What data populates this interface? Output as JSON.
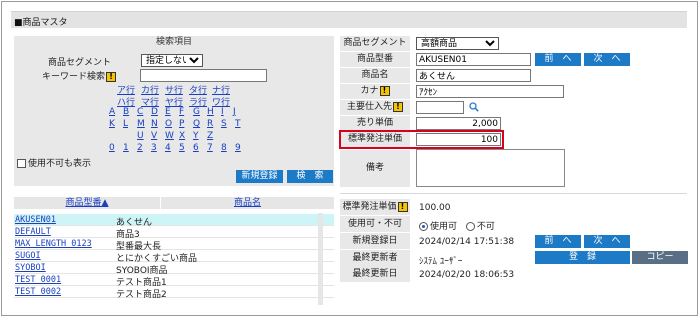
{
  "title": "■商品マスタ",
  "search": {
    "header": "検索項目",
    "segment_label": "商品セグメント",
    "segment_value": "指定しない",
    "keyword_label": "キーワード検索",
    "keyword_value": "",
    "kana_rows": [
      [
        "ア行",
        "カ行",
        "サ行",
        "タ行",
        "ナ行"
      ],
      [
        "ハ行",
        "マ行",
        "ヤ行",
        "ラ行",
        "ワ行"
      ],
      [
        "A",
        "B",
        "C",
        "D",
        "E",
        "F",
        "G",
        "H",
        "I",
        "J"
      ],
      [
        "K",
        "L",
        "M",
        "N",
        "O",
        "P",
        "Q",
        "R",
        "S",
        "T"
      ],
      [
        "U",
        "V",
        "W",
        "X",
        "Y",
        "Z"
      ],
      [
        "0",
        "1",
        "2",
        "3",
        "4",
        "5",
        "6",
        "7",
        "8",
        "9"
      ]
    ],
    "unusable_label": "使用不可も表示",
    "new_button": "新規登録",
    "search_button": "検　索"
  },
  "list": {
    "col_code": "商品型番▲",
    "col_name": "商品名",
    "rows": [
      {
        "code": "AKUSEN01",
        "name": "あくせん"
      },
      {
        "code": "DEFAULT",
        "name": "商品3"
      },
      {
        "code": "MAX LENGTH 0123",
        "name": "型番最大長"
      },
      {
        "code": "SUGOI",
        "name": "とにかくすごい商品"
      },
      {
        "code": "SYOBOI",
        "name": "SYOBOI商品"
      },
      {
        "code": "TEST 0001",
        "name": "テスト商品1"
      },
      {
        "code": "TEST 0002",
        "name": "テスト商品2"
      }
    ]
  },
  "edit": {
    "segment_label": "商品セグメント",
    "segment_value": "高額商品",
    "code_label": "商品型番",
    "code_value": "AKUSEN01",
    "prev_button": "前　へ",
    "next_button": "次　へ",
    "name_label": "商品名",
    "name_value": "あくせん",
    "kana_label": "カナ",
    "kana_value": "ｱｸｾﾝ",
    "supplier_label": "主要仕入先",
    "supplier_value": "",
    "sale_price_label": "売り単価",
    "sale_price_value": "2,000",
    "std_price_label": "標準発注単価",
    "std_price_value": "100",
    "memo_label": "備考",
    "memo_value": ""
  },
  "detail": {
    "std_price_label": "標準発注単価",
    "std_price_value": "100.00",
    "usable_label": "使用可・不可",
    "usable_yes": "使用可",
    "usable_no": "不可",
    "created_label": "新規登録日",
    "created_value": "2024/02/14 17:51:38",
    "updater_label": "最終更新者",
    "updater_value": "ｼｽﾃﾑ ﾕｰｻﾞｰ",
    "updated_label": "最終更新日",
    "updated_value": "2024/02/20 18:06:53",
    "prev_button": "前　へ",
    "next_button": "次　へ",
    "register_button": "登　録",
    "copy_button": "コピー"
  },
  "colors": {
    "accent": "#1c7ac7",
    "highlight_border": "#d9001b",
    "selected_row": "#cdf4f7"
  }
}
